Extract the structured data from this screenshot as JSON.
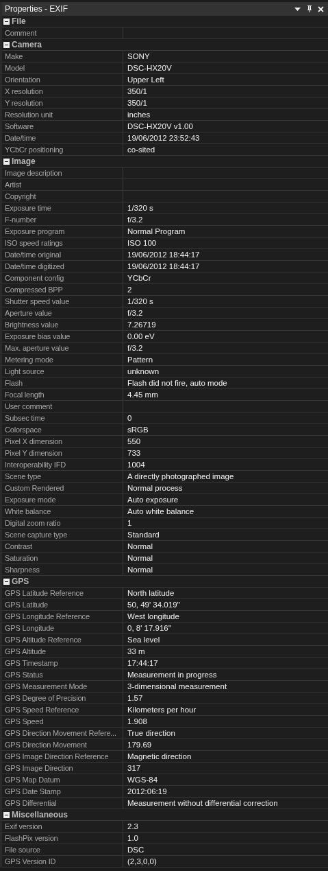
{
  "window": {
    "title": "Properties - EXIF"
  },
  "sections": [
    {
      "title": "File",
      "expanded": true,
      "rows": [
        {
          "label": "Comment"
        }
      ]
    },
    {
      "title": "Camera",
      "expanded": true,
      "rows": [
        {
          "label": "Make",
          "value": "SONY"
        },
        {
          "label": "Model",
          "value": "DSC-HX20V"
        },
        {
          "label": "Orientation",
          "value": "Upper Left"
        },
        {
          "label": "X resolution",
          "value": "350/1"
        },
        {
          "label": "Y resolution",
          "value": "350/1"
        },
        {
          "label": "Resolution unit",
          "value": "inches"
        },
        {
          "label": "Software",
          "value": "DSC-HX20V v1.00"
        },
        {
          "label": "Date/time",
          "value": "19/06/2012 23:52:43"
        },
        {
          "label": "YCbCr positioning",
          "value": "co-sited"
        }
      ]
    },
    {
      "title": "Image",
      "expanded": true,
      "rows": [
        {
          "label": "Image description"
        },
        {
          "label": "Artist"
        },
        {
          "label": "Copyright"
        },
        {
          "label": "Exposure time",
          "value": "1/320 s"
        },
        {
          "label": "F-number",
          "value": "f/3.2"
        },
        {
          "label": "Exposure program",
          "value": "Normal Program"
        },
        {
          "label": "ISO speed ratings",
          "value": "ISO 100"
        },
        {
          "label": "Date/time original",
          "value": "19/06/2012 18:44:17"
        },
        {
          "label": "Date/time digitized",
          "value": "19/06/2012 18:44:17"
        },
        {
          "label": "Component config",
          "value": "YCbCr"
        },
        {
          "label": "Compressed BPP",
          "value": "2"
        },
        {
          "label": "Shutter speed value",
          "value": "1/320 s"
        },
        {
          "label": "Aperture value",
          "value": "f/3.2"
        },
        {
          "label": "Brightness value",
          "value": "7.26719"
        },
        {
          "label": "Exposure bias value",
          "value": "0.00 eV"
        },
        {
          "label": "Max. aperture value",
          "value": "f/3.2"
        },
        {
          "label": "Metering mode",
          "value": "Pattern"
        },
        {
          "label": "Light source",
          "value": "unknown"
        },
        {
          "label": "Flash",
          "value": "Flash did not fire, auto mode"
        },
        {
          "label": "Focal length",
          "value": "4.45 mm"
        },
        {
          "label": "User comment"
        },
        {
          "label": "Subsec time",
          "value": "0"
        },
        {
          "label": "Colorspace",
          "value": "sRGB"
        },
        {
          "label": "Pixel X dimension",
          "value": "550"
        },
        {
          "label": "Pixel Y dimension",
          "value": "733"
        },
        {
          "label": "Interoperability IFD",
          "value": "1004"
        },
        {
          "label": "Scene type",
          "value": "A directly photographed image"
        },
        {
          "label": "Custom Rendered",
          "value": "Normal process"
        },
        {
          "label": "Exposure mode",
          "value": "Auto exposure"
        },
        {
          "label": "White balance",
          "value": "Auto white balance"
        },
        {
          "label": "Digital zoom ratio",
          "value": "1"
        },
        {
          "label": "Scene capture type",
          "value": "Standard"
        },
        {
          "label": "Contrast",
          "value": "Normal"
        },
        {
          "label": "Saturation",
          "value": "Normal"
        },
        {
          "label": "Sharpness",
          "value": "Normal"
        }
      ]
    },
    {
      "title": "GPS",
      "expanded": true,
      "rows": [
        {
          "label": "GPS Latitude Reference",
          "value": "North latitude"
        },
        {
          "label": "GPS Latitude",
          "value": "50, 49' 34.019''"
        },
        {
          "label": "GPS Longitude Reference",
          "value": "West longitude"
        },
        {
          "label": "GPS Longitude",
          "value": "0, 8' 17.916''"
        },
        {
          "label": "GPS Altitude Reference",
          "value": "Sea level"
        },
        {
          "label": "GPS Altitude",
          "value": "33 m"
        },
        {
          "label": "GPS Timestamp",
          "value": "17:44:17"
        },
        {
          "label": "GPS Status",
          "value": "Measurement in progress"
        },
        {
          "label": "GPS Measurement Mode",
          "value": "3-dimensional measurement"
        },
        {
          "label": "GPS Degree of Precision",
          "value": "1.57"
        },
        {
          "label": "GPS Speed Reference",
          "value": "Kilometers per hour"
        },
        {
          "label": "GPS Speed",
          "value": "1.908"
        },
        {
          "label": "GPS Direction Movement Refere...",
          "value": "True direction"
        },
        {
          "label": "GPS Direction Movement",
          "value": "179.69"
        },
        {
          "label": "GPS Image Direction Reference",
          "value": "Magnetic direction"
        },
        {
          "label": "GPS Image Direction",
          "value": "317"
        },
        {
          "label": "GPS Map Datum",
          "value": "WGS-84"
        },
        {
          "label": "GPS Date Stamp",
          "value": "2012:06:19"
        },
        {
          "label": "GPS Differential",
          "value": "Measurement without differential correction"
        }
      ]
    },
    {
      "title": "Miscellaneous",
      "expanded": true,
      "rows": [
        {
          "label": "Exif version",
          "value": "2.3"
        },
        {
          "label": "FlashPix version",
          "value": "1.0"
        },
        {
          "label": "File source",
          "value": "DSC"
        },
        {
          "label": "GPS Version ID",
          "value": "(2,3,0,0)"
        }
      ]
    }
  ]
}
